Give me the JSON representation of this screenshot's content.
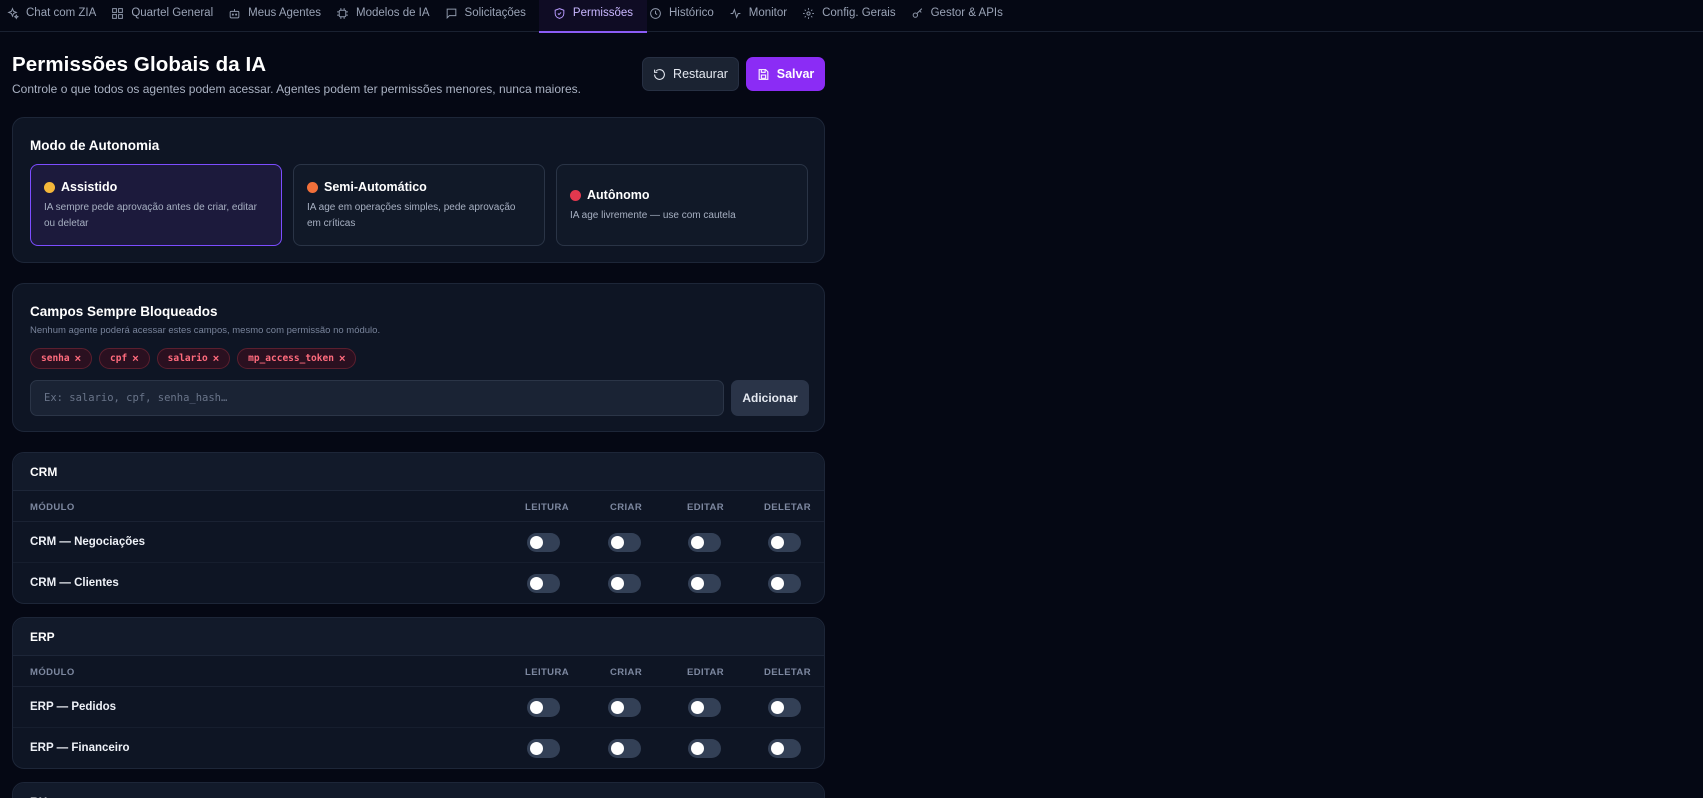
{
  "nav": {
    "items": [
      {
        "label": "Chat com ZIA",
        "icon": "sparkles-icon"
      },
      {
        "label": "Quartel General",
        "icon": "grid-icon"
      },
      {
        "label": "Meus Agentes",
        "icon": "bot-icon"
      },
      {
        "label": "Modelos de IA",
        "icon": "chip-icon"
      },
      {
        "label": "Solicitações",
        "icon": "message-icon"
      },
      {
        "label": "Permissões",
        "icon": "shield-icon",
        "active": true
      },
      {
        "label": "Histórico",
        "icon": "clock-icon"
      },
      {
        "label": "Monitor",
        "icon": "activity-icon"
      },
      {
        "label": "Config. Gerais",
        "icon": "gear-icon"
      },
      {
        "label": "Gestor & APIs",
        "icon": "key-icon"
      }
    ]
  },
  "header": {
    "title": "Permissões Globais da IA",
    "subtitle": "Controle o que todos os agentes podem acessar. Agentes podem ter permissões menores, nunca maiores.",
    "restore_label": "Restaurar",
    "save_label": "Salvar"
  },
  "autonomy": {
    "title": "Modo de Autonomia",
    "modes": [
      {
        "name": "Assistido",
        "desc": "IA sempre pede aprovação antes de criar, editar ou deletar",
        "color": "#f4b73a",
        "selected": true
      },
      {
        "name": "Semi-Automático",
        "desc": "IA age em operações simples, pede aprovação em críticas",
        "color": "#f2703a",
        "selected": false
      },
      {
        "name": "Autônomo",
        "desc": "IA age livremente — use com cautela",
        "color": "#e3384e",
        "selected": false
      }
    ]
  },
  "blocked": {
    "title": "Campos Sempre Bloqueados",
    "subtitle": "Nenhum agente poderá acessar estes campos, mesmo com permissão no módulo.",
    "chips": [
      "senha",
      "cpf",
      "salario",
      "mp_access_token"
    ],
    "chip_remove": "×",
    "placeholder": "Ex: salario, cpf, senha_hash…",
    "add_label": "Adicionar"
  },
  "columns": {
    "module": "MÓDULO",
    "read": "LEITURA",
    "create": "CRIAR",
    "edit": "EDITAR",
    "delete": "DELETAR"
  },
  "sections": [
    {
      "title": "CRM",
      "rows": [
        {
          "label": "CRM — Negociações",
          "read": false,
          "create": false,
          "edit": false,
          "delete": false
        },
        {
          "label": "CRM — Clientes",
          "read": false,
          "create": false,
          "edit": false,
          "delete": false
        }
      ]
    },
    {
      "title": "ERP",
      "rows": [
        {
          "label": "ERP — Pedidos",
          "read": false,
          "create": false,
          "edit": false,
          "delete": false
        },
        {
          "label": "ERP — Financeiro",
          "read": false,
          "create": false,
          "edit": false,
          "delete": false
        }
      ]
    },
    {
      "title": "RH",
      "rows": []
    }
  ],
  "colors": {
    "accent": "#8b2cf5",
    "danger_chip_text": "#ff6b7d",
    "background": "#050814"
  }
}
